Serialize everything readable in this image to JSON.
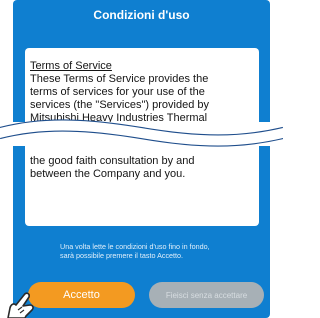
{
  "header": {
    "title": "Condizioni d'uso"
  },
  "terms": {
    "lines_top": [
      "Terms of Service",
      "These Terms of Service provides the",
      "terms of services for your use of the",
      "services (the \"Services\") provided by",
      "Mitsubishi Heavy Industries Thermal"
    ],
    "lines_bottom": [
      "the good faith consultation by and",
      "between the Company and you."
    ]
  },
  "note": {
    "text": "Una volta lette le condizioni d'uso fino in fondo, sarà possibile premere il tasto Accetto."
  },
  "buttons": {
    "accept_label": "Accetto",
    "exit_label": "Fieisci senza accettare"
  },
  "colors": {
    "background": "#0f7fd0",
    "accent": "#f39a21",
    "disabled": "#a7b0b6"
  },
  "icons": {
    "pointer": "hand-pointer-icon"
  }
}
